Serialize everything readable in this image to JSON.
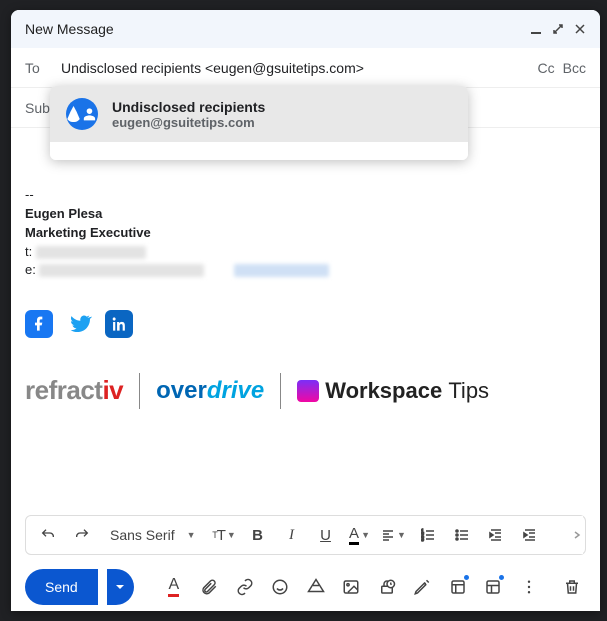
{
  "header": {
    "title": "New Message"
  },
  "to": {
    "label": "To",
    "value": "Undisclosed recipients <eugen@gsuitetips.com>",
    "cc_label": "Cc",
    "bcc_label": "Bcc"
  },
  "subject": {
    "label": "Sub"
  },
  "suggestion": {
    "name": "Undisclosed recipients",
    "email": "eugen@gsuitetips.com"
  },
  "signature": {
    "dashes": "--",
    "name": "Eugen Plesa",
    "title": "Marketing Executive",
    "t_label": "t:",
    "e_label": "e:"
  },
  "logos": {
    "refractiv_part1": "refract",
    "refractiv_part2": "iv",
    "overdrive_part1": "over",
    "overdrive_part2": "drive",
    "workspace": "Workspace",
    "tips": "Tips"
  },
  "format_bar": {
    "font": "Sans Serif",
    "undo": "↶",
    "redo": "↷",
    "size": "тT",
    "bold": "B",
    "italic": "I",
    "underline": "U",
    "color": "A"
  },
  "actions": {
    "send": "Send",
    "format_A": "A"
  }
}
